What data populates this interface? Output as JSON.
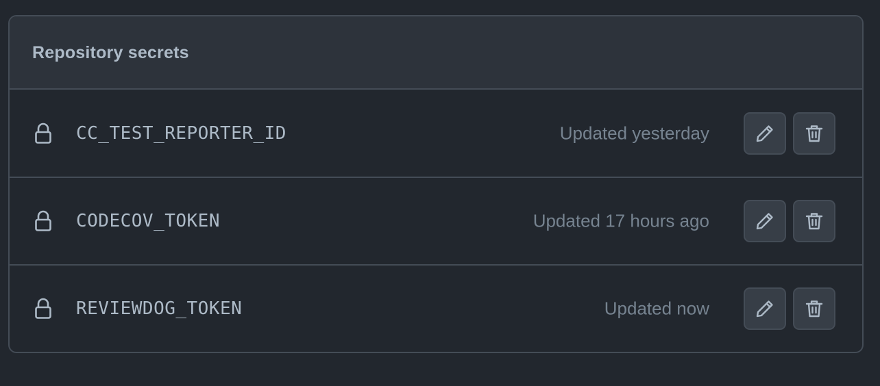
{
  "section": {
    "title": "Repository secrets"
  },
  "secrets": [
    {
      "name": "CC_TEST_REPORTER_ID",
      "updated": "Updated yesterday",
      "icon": "lock-icon"
    },
    {
      "name": "CODECOV_TOKEN",
      "updated": "Updated 17 hours ago",
      "icon": "lock-icon"
    },
    {
      "name": "REVIEWDOG_TOKEN",
      "updated": "Updated now",
      "icon": "lock-icon"
    }
  ],
  "actions": {
    "edit_icon": "pencil-icon",
    "delete_icon": "trash-icon"
  },
  "colors": {
    "background": "#22272e",
    "header_background": "#2d333b",
    "border": "#444c56",
    "text_primary": "#adbac7",
    "text_muted": "#768390",
    "button_background": "#373e47"
  }
}
